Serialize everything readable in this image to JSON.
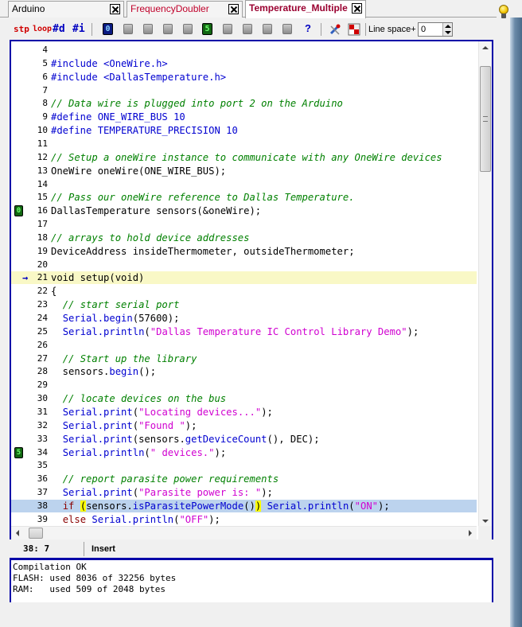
{
  "tabs": [
    {
      "label": "Arduino",
      "active": false
    },
    {
      "label": "FrequencyDoubler",
      "active": false
    },
    {
      "label": "Temperature_Multiple",
      "active": true
    }
  ],
  "toolbar": {
    "stp": "stp",
    "loop": "loop",
    "define": "#d",
    "include": "#i",
    "bookmark0": "0",
    "bookmark5": "5",
    "help": "?",
    "line_space_label": "Line space+",
    "line_space_value": "0"
  },
  "code_lines": [
    {
      "num": "4",
      "parts": []
    },
    {
      "num": "5",
      "parts": [
        {
          "c": "pp",
          "t": "#include <OneWire.h>"
        }
      ]
    },
    {
      "num": "6",
      "parts": [
        {
          "c": "pp",
          "t": "#include <DallasTemperature.h>"
        }
      ]
    },
    {
      "num": "7",
      "parts": []
    },
    {
      "num": "8",
      "parts": [
        {
          "c": "cm",
          "t": "// Data wire is plugged into port 2 on the Arduino"
        }
      ]
    },
    {
      "num": "9",
      "parts": [
        {
          "c": "pp",
          "t": "#define ONE_WIRE_BUS 10"
        }
      ]
    },
    {
      "num": "10",
      "parts": [
        {
          "c": "pp",
          "t": "#define TEMPERATURE_PRECISION 10"
        }
      ]
    },
    {
      "num": "11",
      "parts": []
    },
    {
      "num": "12",
      "parts": [
        {
          "c": "cm",
          "t": "// Setup a oneWire instance to communicate with any OneWire devices"
        }
      ]
    },
    {
      "num": "13",
      "parts": [
        {
          "c": "pl",
          "t": "OneWire oneWire(ONE_WIRE_BUS);"
        }
      ]
    },
    {
      "num": "14",
      "parts": []
    },
    {
      "num": "15",
      "parts": [
        {
          "c": "cm",
          "t": "// Pass our oneWire reference to Dallas Temperature."
        }
      ]
    },
    {
      "num": "16",
      "mark": "0",
      "parts": [
        {
          "c": "pl",
          "t": "DallasTemperature sensors(&oneWire);"
        }
      ]
    },
    {
      "num": "17",
      "parts": []
    },
    {
      "num": "18",
      "parts": [
        {
          "c": "cm",
          "t": "// arrays to hold device addresses"
        }
      ]
    },
    {
      "num": "19",
      "parts": [
        {
          "c": "pl",
          "t": "DeviceAddress insideThermometer, outsideThermometer;"
        }
      ]
    },
    {
      "num": "20",
      "parts": []
    },
    {
      "num": "21",
      "arrow": "→",
      "hl": "yellow",
      "parts": [
        {
          "c": "pl",
          "t": "void setup(void)"
        }
      ]
    },
    {
      "num": "22",
      "parts": [
        {
          "c": "pl",
          "t": "{"
        }
      ]
    },
    {
      "num": "23",
      "parts": [
        {
          "c": "pl",
          "t": "  "
        },
        {
          "c": "cm",
          "t": "// start serial port"
        }
      ]
    },
    {
      "num": "24",
      "parts": [
        {
          "c": "pl",
          "t": "  "
        },
        {
          "c": "lib",
          "t": "Serial.begin"
        },
        {
          "c": "pl",
          "t": "(57600);"
        }
      ]
    },
    {
      "num": "25",
      "parts": [
        {
          "c": "pl",
          "t": "  "
        },
        {
          "c": "lib",
          "t": "Serial.println"
        },
        {
          "c": "pl",
          "t": "("
        },
        {
          "c": "st",
          "t": "\"Dallas Temperature IC Control Library Demo\""
        },
        {
          "c": "pl",
          "t": ");"
        }
      ]
    },
    {
      "num": "26",
      "parts": []
    },
    {
      "num": "27",
      "parts": [
        {
          "c": "pl",
          "t": "  "
        },
        {
          "c": "cm",
          "t": "// Start up the library"
        }
      ]
    },
    {
      "num": "28",
      "parts": [
        {
          "c": "pl",
          "t": "  sensors."
        },
        {
          "c": "lib",
          "t": "begin"
        },
        {
          "c": "pl",
          "t": "();"
        }
      ]
    },
    {
      "num": "29",
      "parts": []
    },
    {
      "num": "30",
      "parts": [
        {
          "c": "pl",
          "t": "  "
        },
        {
          "c": "cm",
          "t": "// locate devices on the bus"
        }
      ]
    },
    {
      "num": "31",
      "parts": [
        {
          "c": "pl",
          "t": "  "
        },
        {
          "c": "lib",
          "t": "Serial.print"
        },
        {
          "c": "pl",
          "t": "("
        },
        {
          "c": "st",
          "t": "\"Locating devices...\""
        },
        {
          "c": "pl",
          "t": ");"
        }
      ]
    },
    {
      "num": "32",
      "parts": [
        {
          "c": "pl",
          "t": "  "
        },
        {
          "c": "lib",
          "t": "Serial.print"
        },
        {
          "c": "pl",
          "t": "("
        },
        {
          "c": "st",
          "t": "\"Found \""
        },
        {
          "c": "pl",
          "t": ");"
        }
      ]
    },
    {
      "num": "33",
      "parts": [
        {
          "c": "pl",
          "t": "  "
        },
        {
          "c": "lib",
          "t": "Serial.print"
        },
        {
          "c": "pl",
          "t": "(sensors."
        },
        {
          "c": "lib",
          "t": "getDeviceCount"
        },
        {
          "c": "pl",
          "t": "(), DEC);"
        }
      ]
    },
    {
      "num": "34",
      "mark": "5",
      "parts": [
        {
          "c": "pl",
          "t": "  "
        },
        {
          "c": "lib",
          "t": "Serial.println"
        },
        {
          "c": "pl",
          "t": "("
        },
        {
          "c": "st",
          "t": "\" devices.\""
        },
        {
          "c": "pl",
          "t": ");"
        }
      ]
    },
    {
      "num": "35",
      "parts": []
    },
    {
      "num": "36",
      "parts": [
        {
          "c": "pl",
          "t": "  "
        },
        {
          "c": "cm",
          "t": "// report parasite power requirements"
        }
      ]
    },
    {
      "num": "37",
      "parts": [
        {
          "c": "pl",
          "t": "  "
        },
        {
          "c": "lib",
          "t": "Serial.print"
        },
        {
          "c": "pl",
          "t": "("
        },
        {
          "c": "st",
          "t": "\"Parasite power is: \""
        },
        {
          "c": "pl",
          "t": ");"
        }
      ]
    },
    {
      "num": "38",
      "hl": "blue",
      "parts": [
        {
          "c": "pl",
          "t": "  "
        },
        {
          "c": "kw",
          "t": "if"
        },
        {
          "c": "pl",
          "t": " "
        },
        {
          "c": "br",
          "t": "("
        },
        {
          "c": "pl",
          "t": "sensors."
        },
        {
          "c": "lib",
          "t": "isParasitePowerMode"
        },
        {
          "c": "pl",
          "t": "()"
        },
        {
          "c": "br",
          "t": ")"
        },
        {
          "c": "pl",
          "t": " "
        },
        {
          "c": "lib",
          "t": "Serial.println"
        },
        {
          "c": "pl",
          "t": "("
        },
        {
          "c": "st",
          "t": "\"ON\""
        },
        {
          "c": "pl",
          "t": ");"
        }
      ]
    },
    {
      "num": "39",
      "parts": [
        {
          "c": "pl",
          "t": "  "
        },
        {
          "c": "kw",
          "t": "else"
        },
        {
          "c": "pl",
          "t": " "
        },
        {
          "c": "lib",
          "t": "Serial.println"
        },
        {
          "c": "pl",
          "t": "("
        },
        {
          "c": "st",
          "t": "\"OFF\""
        },
        {
          "c": "pl",
          "t": ");"
        }
      ]
    }
  ],
  "status": {
    "position": "38: 7",
    "mode": "Insert"
  },
  "output": {
    "lines": [
      "Compilation OK",
      "FLASH: used 8036 of 32256 bytes",
      "RAM:   used 509 of 2048 bytes"
    ]
  },
  "colors": {
    "frame": "#0000a8",
    "preprocessor": "#0000d0",
    "comment": "#008000",
    "string": "#d000d0",
    "keyword": "#8a0000",
    "current_line": "#f9f8c6",
    "selected_line": "#bcd3ee",
    "bracket_match": "#ffff00"
  },
  "icons": [
    "close-icon",
    "lightbulb-icon",
    "bookmark-icon",
    "gray-bookmark-icon",
    "help-icon",
    "wrench-icon",
    "palette-icon",
    "arrow-right-icon",
    "spin-up-icon",
    "spin-down-icon"
  ]
}
